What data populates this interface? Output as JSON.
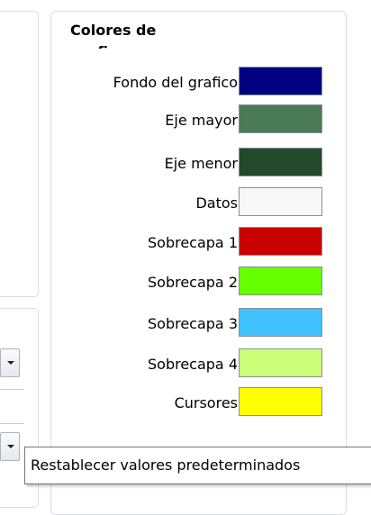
{
  "panel": {
    "title": "Colores de grafico"
  },
  "colors": [
    {
      "label": "Fondo del grafico",
      "color": "#000080"
    },
    {
      "label": "Eje mayor",
      "color": "#4a7a56"
    },
    {
      "label": "Eje menor",
      "color": "#224a2a"
    },
    {
      "label": "Datos",
      "color": "#f8f8f8"
    },
    {
      "label": "Sobrecapa 1",
      "color": "#c80000"
    },
    {
      "label": "Sobrecapa 2",
      "color": "#66ff00"
    },
    {
      "label": "Sobrecapa 3",
      "color": "#3fc2ff"
    },
    {
      "label": "Sobrecapa 4",
      "color": "#ccff77"
    },
    {
      "label": "Cursores",
      "color": "#ffff00"
    }
  ],
  "tooltip": {
    "text": "Restablecer valores predeterminados"
  }
}
